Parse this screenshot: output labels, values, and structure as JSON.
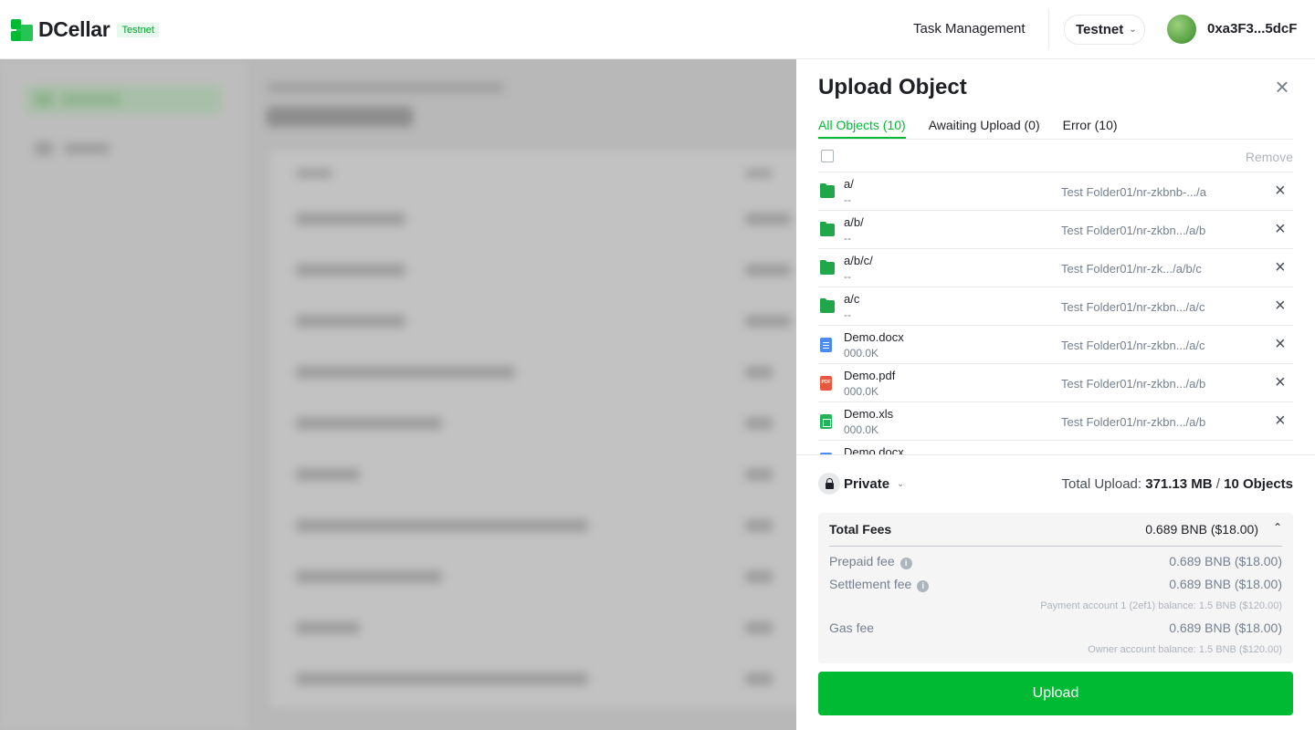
{
  "header": {
    "logo_text": "DCellar",
    "net_badge": "Testnet",
    "task_management": "Task Management",
    "network": "Testnet",
    "address": "0xa3F3...5dcF"
  },
  "drawer": {
    "title": "Upload Object",
    "tabs": [
      {
        "label": "All Objects (10)",
        "active": true
      },
      {
        "label": "Awaiting Upload (0)",
        "active": false
      },
      {
        "label": "Error (10)",
        "active": false
      }
    ],
    "remove_label": "Remove",
    "rows": [
      {
        "name": "a/",
        "size": "--",
        "path": "Test Folder01/nr-zkbnb-.../a",
        "icon": "folder-icon"
      },
      {
        "name": "a/b/",
        "size": "--",
        "path": "Test Folder01/nr-zkbn.../a/b",
        "icon": "folder-icon"
      },
      {
        "name": "a/b/c/",
        "size": "--",
        "path": "Test Folder01/nr-zk.../a/b/c",
        "icon": "folder-icon"
      },
      {
        "name": "a/c",
        "size": "--",
        "path": "Test Folder01/nr-zkbn.../a/c",
        "icon": "folder-icon"
      },
      {
        "name": "Demo.docx",
        "size": "000.0K",
        "path": "Test Folder01/nr-zkbn.../a/c",
        "icon": "docx-icon"
      },
      {
        "name": "Demo.pdf",
        "size": "000.0K",
        "path": "Test Folder01/nr-zkbn.../a/b",
        "icon": "pdf-icon"
      },
      {
        "name": "Demo.xls",
        "size": "000.0K",
        "path": "Test Folder01/nr-zkbn.../a/b",
        "icon": "xls-icon"
      },
      {
        "name": "Demo.docx",
        "size": "",
        "path": "",
        "icon": "docx-icon"
      }
    ],
    "visibility": "Private",
    "total_upload_label": "Total Upload:",
    "total_size": "371.13 MB",
    "total_objects": "10 Objects",
    "fees": {
      "title": "Total Fees",
      "total": "0.689 BNB ($18.00)",
      "prepaid_label": "Prepaid fee",
      "prepaid_value": "0.689 BNB ($18.00)",
      "settlement_label": "Settlement fee",
      "settlement_value": "0.689 BNB ($18.00)",
      "payment_note": "Payment account 1 (2ef1) balance: 1.5 BNB ($120.00)",
      "gas_label": "Gas fee",
      "gas_value": "0.689 BNB ($18.00)",
      "owner_note": "Owner account balance: 1.5 BNB ($120.00)"
    },
    "upload_button": "Upload"
  },
  "colors": {
    "accent": "#00ba34",
    "text": "#1e2026",
    "muted": "#76808f"
  }
}
